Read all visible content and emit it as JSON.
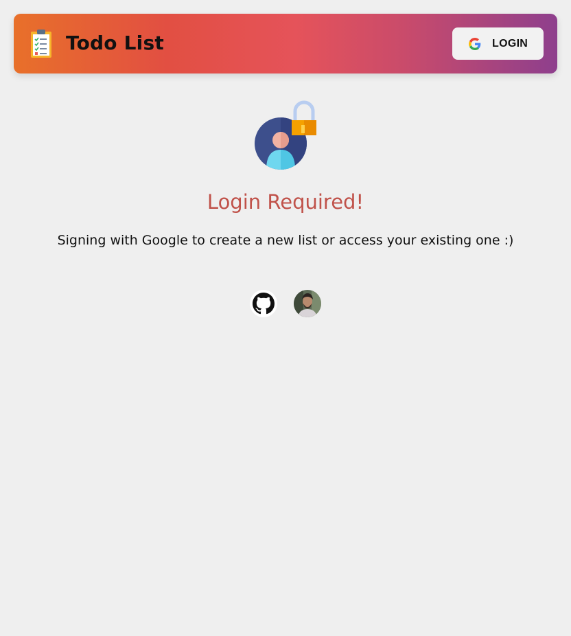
{
  "header": {
    "title": "Todo List",
    "login_label": "LOGIN",
    "logo_icon": "clipboard-checklist-icon",
    "login_icon": "google-icon"
  },
  "main": {
    "illustration_icon": "user-lock-icon",
    "title": "Login Required!",
    "message": "Signing with Google to create a new list or access your existing one :)"
  },
  "footer_links": [
    {
      "icon": "github-icon"
    },
    {
      "icon": "developer-avatar"
    }
  ],
  "colors": {
    "background": "#efefef",
    "title": "#c0524a",
    "gradient_start": "#e8702a",
    "gradient_end": "#8e3f8d"
  }
}
